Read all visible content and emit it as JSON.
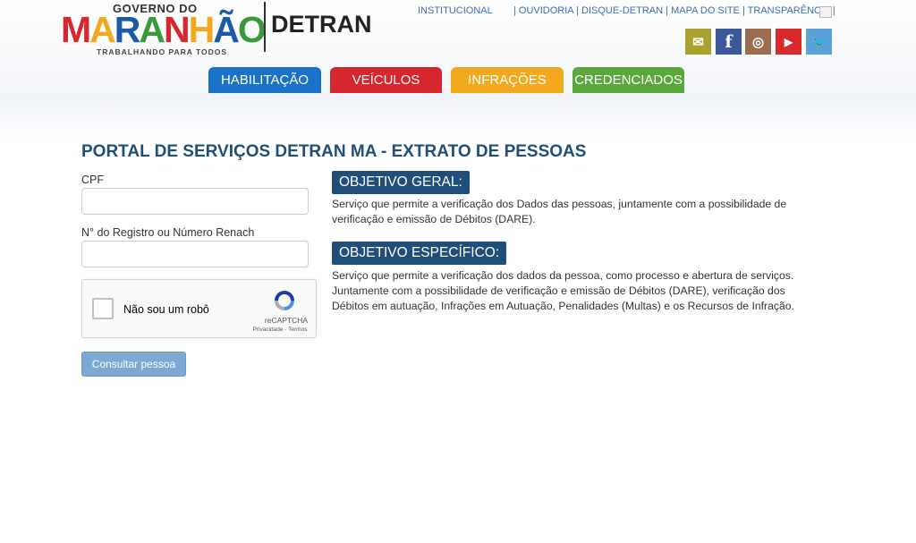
{
  "header": {
    "logo": {
      "governo": "GOVERNO DO",
      "word_letters": [
        "M",
        "A",
        "R",
        "A",
        "N",
        "H",
        "Ã",
        "O"
      ],
      "slogan": "TRABALHANDO PARA TODOS"
    },
    "detran_label": "DETRAN",
    "links": {
      "institucional": "INSTITUCIONAL",
      "rest": [
        "| OUVIDORIA",
        "| DISQUE-DETRAN",
        "| MAPA DO SITE",
        "| TRANSPARÊNCIA |"
      ]
    },
    "social": [
      {
        "icon": "mail-icon",
        "glyph": "✉",
        "color": "#a9a32e"
      },
      {
        "icon": "facebook-icon",
        "glyph": "f",
        "color": "#3b5998"
      },
      {
        "icon": "instagram-icon",
        "glyph": "◎",
        "color": "#9b6d4f"
      },
      {
        "icon": "youtube-icon",
        "glyph": "▶",
        "color": "#d82a2a"
      },
      {
        "icon": "twitter-icon",
        "glyph": "🐦",
        "color": "#5aa3d9"
      }
    ],
    "tabs": [
      {
        "label": "HABILITAÇÃO",
        "color": "#1a73c8"
      },
      {
        "label": "VEÍCULOS",
        "color": "#d6262e"
      },
      {
        "label": "INFRAÇÕES",
        "color": "#f2a91e"
      },
      {
        "label": "CREDENCIADOS",
        "color": "#5aa83c"
      }
    ]
  },
  "main": {
    "title": "PORTAL DE SERVIÇOS DETRAN MA - EXTRATO DE PESSOAS",
    "form": {
      "cpf_label": "CPF",
      "registro_label": "N° do Registro ou Número Renach",
      "captcha_text": "Não sou um robô",
      "captcha_brand": "reCAPTCHA",
      "captcha_links": "Privacidade - Termos",
      "submit_label": "Consultar pessoa"
    },
    "objetivo_geral": {
      "heading": "OBJETIVO GERAL:",
      "text": "Serviço que permite a verificação dos Dados das pessoas, juntamente com a possibilidade de verificação e emissão de Débitos (DARE)."
    },
    "objetivo_especifico": {
      "heading": "OBJETIVO ESPECÍFICO:",
      "text": "Serviço que permite a verificação dos dados da pessoa, como processo e abertura de serviços. Juntamente com a possibilidade de verificação e emissão de Débitos (DARE), verificação dos Débitos em autuação, Infrações em Autuação, Penalidades (Multas) e os Recursos de Infração."
    }
  }
}
